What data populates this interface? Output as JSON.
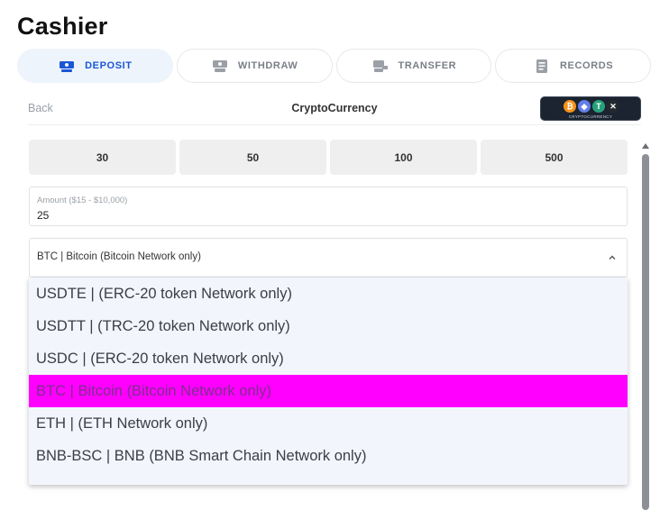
{
  "page": {
    "title": "Cashier"
  },
  "tabs": [
    {
      "label": "DEPOSIT",
      "icon": "deposit-icon",
      "active": true
    },
    {
      "label": "WITHDRAW",
      "icon": "withdraw-icon",
      "active": false
    },
    {
      "label": "TRANSFER",
      "icon": "transfer-icon",
      "active": false
    },
    {
      "label": "RECORDS",
      "icon": "records-icon",
      "active": false
    }
  ],
  "subheader": {
    "back_label": "Back",
    "title": "CryptoCurrency",
    "badge": {
      "label": "CRYPTOCURRENCY",
      "coins": [
        "₿",
        "◆",
        "T",
        "✕"
      ]
    }
  },
  "presets": [
    "30",
    "50",
    "100",
    "500"
  ],
  "amount": {
    "label": "Amount ($15 - $10,000)",
    "value": "25"
  },
  "currency_select": {
    "selected": "BTC | Bitcoin (Bitcoin Network only)",
    "options": [
      "USDTE | (ERC-20 token Network only)",
      "USDTT | (TRC-20 token Network only)",
      "USDC | (ERC-20 token Network only)",
      "BTC | Bitcoin (Bitcoin Network only)",
      "ETH | (ETH Network only)",
      "BNB-BSC | BNB (BNB Smart Chain Network only)"
    ]
  },
  "colors": {
    "accent": "#1a56d6",
    "active_tab_bg": "#eef4fc",
    "highlight": "#ff00ff"
  }
}
